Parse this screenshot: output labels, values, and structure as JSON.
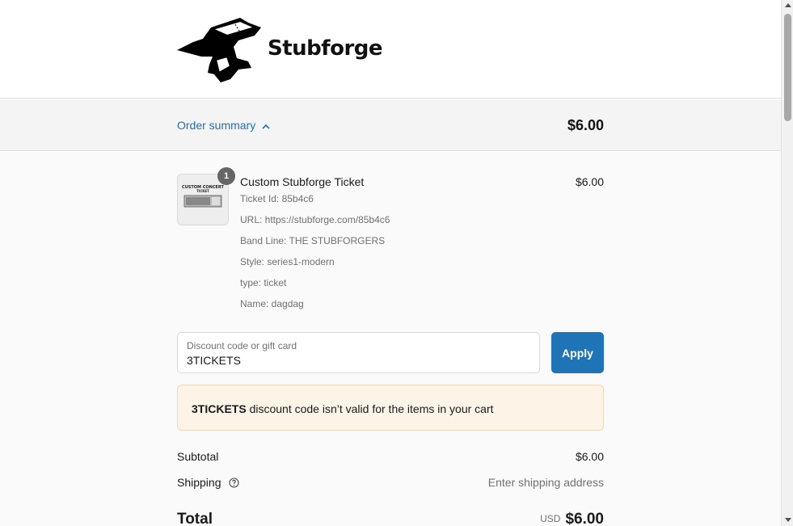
{
  "header": {
    "brand_name": "Stubforge",
    "logo_icon": "anvil-icon"
  },
  "summary": {
    "toggle_label": "Order summary",
    "toggle_icon": "chevron-up-icon",
    "total": "$6.00"
  },
  "cart": {
    "items": [
      {
        "quantity": "1",
        "title": "Custom Stubforge Ticket",
        "price": "$6.00",
        "thumbnail_caption": "CUSTOM CONCERT TICKET",
        "properties": [
          "Ticket Id: 85b4c6",
          "URL: https://stubforge.com/85b4c6",
          "Band Line: THE STUBFORGERS",
          "Style: series1-modern",
          "type: ticket",
          "Name: dagdag"
        ]
      }
    ]
  },
  "discount": {
    "label": "Discount code or gift card",
    "value": "3TICKETS",
    "apply_label": "Apply"
  },
  "alert": {
    "code": "3TICKETS",
    "message": " discount code isn’t valid for the items in your cart"
  },
  "totals": {
    "subtotal_label": "Subtotal",
    "subtotal_value": "$6.00",
    "shipping_label": "Shipping",
    "shipping_value": "Enter shipping address",
    "shipping_help_icon": "question-circle-icon",
    "total_label": "Total",
    "currency": "USD",
    "total_value": "$6.00"
  },
  "colors": {
    "accent": "#1f73b7",
    "link": "#1f6fb2",
    "alert_bg": "#fdf3e6",
    "summary_bg": "#f4f4f4"
  }
}
